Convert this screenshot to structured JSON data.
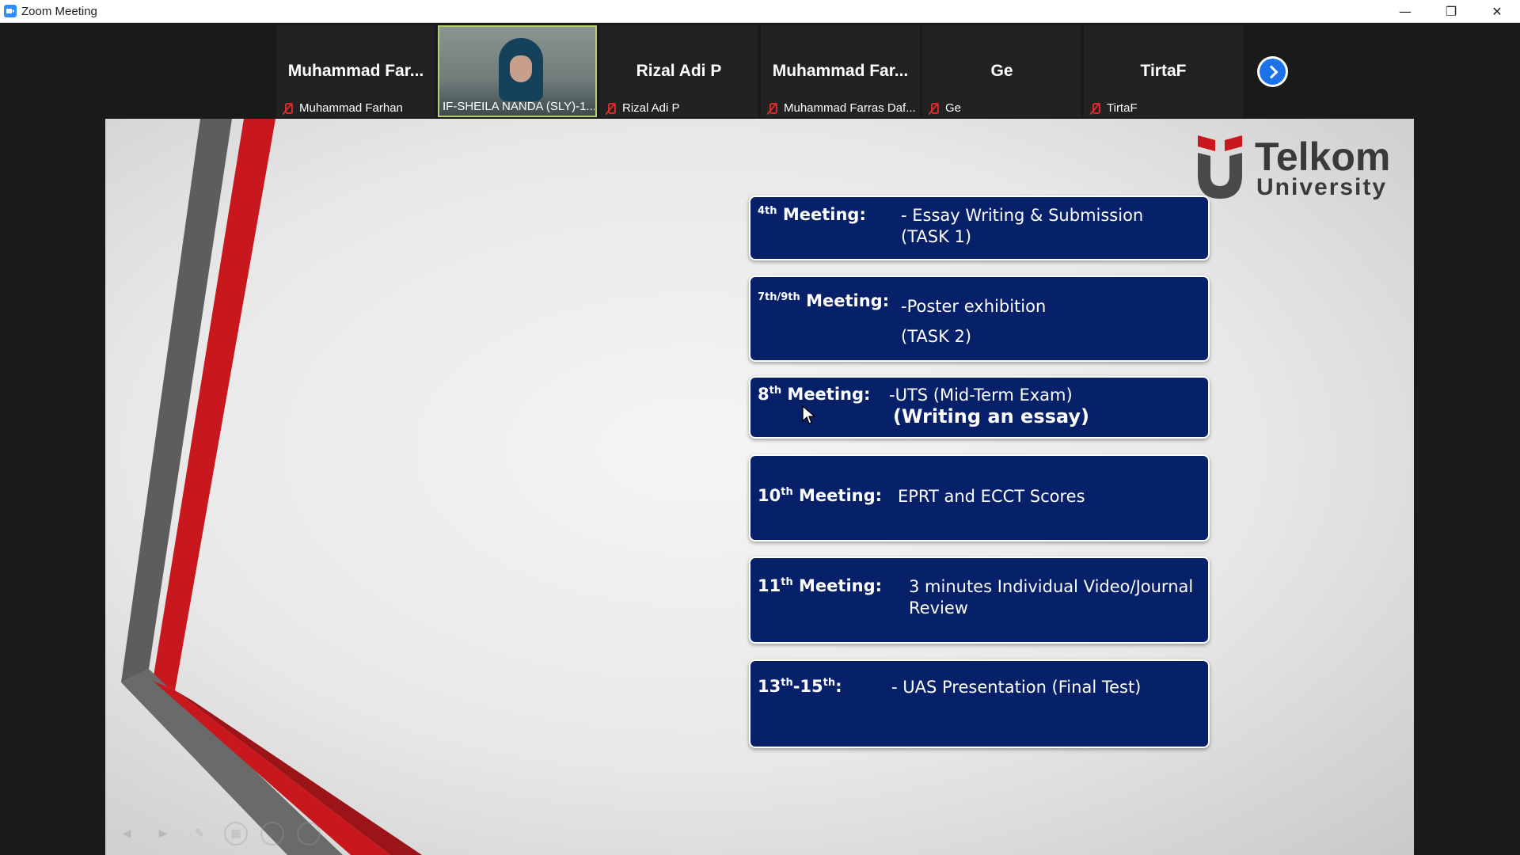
{
  "window": {
    "title": "Zoom Meeting",
    "controls": [
      "—",
      "❐",
      "✕"
    ]
  },
  "participants": [
    {
      "display_name": "Muhammad  Far...",
      "label": "Muhammad Farhan",
      "muted": true,
      "video": false
    },
    {
      "display_name": "",
      "label": "IF-SHEILA NANDA (SLY)-1...",
      "muted": false,
      "video": true
    },
    {
      "display_name": "Rizal Adi P",
      "label": "Rizal Adi P",
      "muted": true,
      "video": false
    },
    {
      "display_name": "Muhammad  Far...",
      "label": "Muhammad Farras Daf...",
      "muted": true,
      "video": false
    },
    {
      "display_name": "Ge",
      "label": "Ge",
      "muted": true,
      "video": false
    },
    {
      "display_name": "TirtaF",
      "label": "TirtaF",
      "muted": true,
      "video": false
    }
  ],
  "next_page_icon": "chevron-right-icon",
  "slide": {
    "logo": {
      "line1": "Telkom",
      "line2": "University"
    },
    "schedule": [
      {
        "num": "4",
        "sup": "th",
        "label_suffix": " Meeting:",
        "desc_lines": [
          "- Essay Writing & Submission",
          "(TASK 1)"
        ]
      },
      {
        "num": "7th/9th",
        "sup": "",
        "label_suffix": " Meeting:",
        "desc_lines": [
          "-Poster exhibition",
          "(TASK 2)"
        ]
      },
      {
        "num": "8",
        "sup": "th",
        "label_suffix": " Meeting:",
        "desc_lines": [
          "-UTS (Mid-Term Exam)",
          "(Writing an essay)"
        ]
      },
      {
        "num": "10",
        "sup": "th",
        "label_suffix": " Meeting:",
        "desc_lines": [
          "EPRT and ECCT Scores"
        ]
      },
      {
        "num": "11",
        "sup": "th",
        "label_suffix": " Meeting:",
        "desc_lines": [
          "3 minutes Individual Video/Journal",
          "Review"
        ]
      },
      {
        "num": "13",
        "sup": "th",
        "label_suffix": "-15",
        "sup2": "th",
        "label_suffix2": ":",
        "desc_lines": [
          "- UAS Presentation (Final Test)"
        ]
      }
    ]
  },
  "presentation_controls": [
    "previous-icon",
    "next-icon",
    "pen-icon",
    "slides-icon",
    "zoom-icon",
    "more-icon"
  ],
  "colors": {
    "box_fill": "#06206a",
    "accent_red": "#c8171d",
    "accent_gray": "#5a5a5a",
    "zoom_blue": "#1a73e8",
    "muted_red": "#e02828"
  }
}
